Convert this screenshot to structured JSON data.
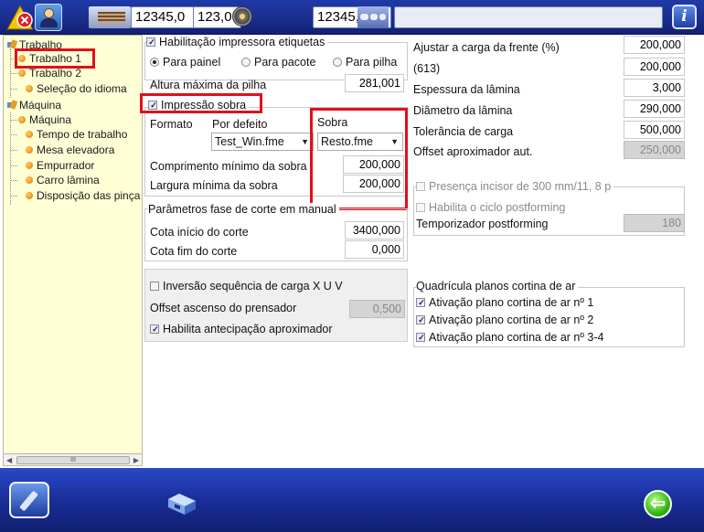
{
  "toolbar": {
    "field_value_1": "12345,0",
    "field_value_2": "123,0",
    "field_value_3": "12345,0",
    "info_label": "i"
  },
  "tree": {
    "items": [
      {
        "label": "Trabalho"
      },
      {
        "label": "Trabalho 1"
      },
      {
        "label": "Trabalho 2"
      },
      {
        "label": "Seleção do idioma"
      },
      {
        "label": "Máquina"
      },
      {
        "label": "Máquina"
      },
      {
        "label": "Tempo de trabalho"
      },
      {
        "label": "Mesa elevadora"
      },
      {
        "label": "Empurrador"
      },
      {
        "label": "Carro lâmina"
      },
      {
        "label": "Disposição das pinça"
      }
    ],
    "scroll_thumb": "III"
  },
  "left": {
    "habilitacao_label": "Habilitação impressora etiquetas",
    "radio_painel": "Para painel",
    "radio_pacote": "Para pacote",
    "radio_pilha": "Para pilha",
    "altura_label": "Altura máxima da pilha",
    "altura_value": "281,001",
    "impressao_label": "Impressão sobra",
    "formato_label": "Formato",
    "por_defeito_label": "Por defeito",
    "sobra_label": "Sobra",
    "por_defeito_value": "Test_Win.fme",
    "sobra_value": "Resto.fme",
    "comprimento_label": "Comprimento mínimo da sobra",
    "comprimento_value": "200,000",
    "largura_label": "Largura mínima da sobra",
    "largura_value": "200,000",
    "parametros_label": "Parâmetros fase de corte em manual",
    "cota_inicio_label": "Cota início do corte",
    "cota_inicio_value": "3400,000",
    "cota_fim_label": "Cota fim do corte",
    "cota_fim_value": "0,000",
    "inversao_label": "Inversão sequência de carga X U V",
    "offset_prensador_label": "Offset ascenso do prensador",
    "offset_prensador_value": "0,500",
    "antecipacao_label": "Habilita antecipação aproximador"
  },
  "right": {
    "ajustar_label": "Ajustar a carga da frente (%)",
    "ajustar_value": "200,000",
    "code_label": "(613)",
    "code_value": "200,000",
    "espessura_label": "Espessura da lâmina",
    "espessura_value": "3,000",
    "diametro_label": "Diâmetro da lâmina",
    "diametro_value": "290,000",
    "tolerancia_label": "Tolerância de carga",
    "tolerancia_value": "500,000",
    "offset_aprox_label": "Offset aproximador aut.",
    "offset_aprox_value": "250,000",
    "presenca_label": "Presença incisor de 300 mm/11, 8 p",
    "habilita_postforming_label": "Habilita o ciclo postforming",
    "temporizador_label": "Temporizador postforming",
    "temporizador_value": "180",
    "quadricula_label": "Quadrícula planos cortina de ar",
    "ativacao_1": "Ativação plano cortina de ar nº 1",
    "ativacao_2": "Ativação plano cortina de ar nº 2",
    "ativacao_3": "Ativação plano cortina de ar nº 3-4"
  },
  "bottom": {
    "back_symbol": "⇦"
  },
  "colors": {
    "toolbar_blue": "#1a2e8c",
    "tree_background": "#ffffd6",
    "highlight_red": "#e0101a",
    "back_button_green": "#36b515"
  }
}
